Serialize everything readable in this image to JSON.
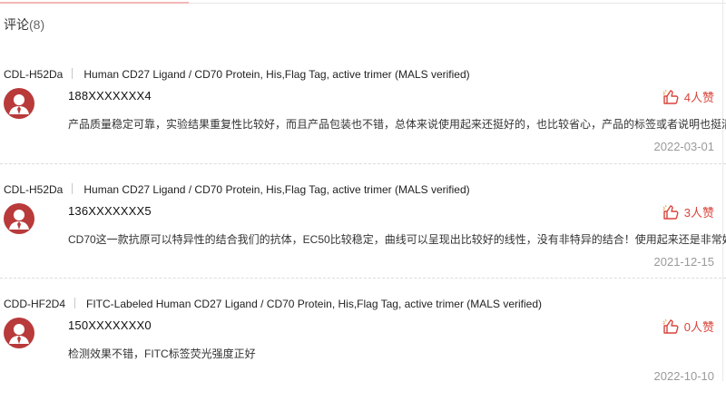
{
  "section": {
    "title": "评论",
    "count": "(8)"
  },
  "reviews": [
    {
      "catalog": "CDL-H52Da",
      "product": "Human CD27 Ligand / CD70 Protein, His,Flag Tag, active trimer (MALS verified)",
      "user": "188XXXXXXX4",
      "likes": "4人赞",
      "comment": "产品质量稳定可靠，实验结果重复性比较好，而且产品包装也不错，总体来说使用起来还挺好的，也比较省心，产品的标签或者说明也挺清晰的",
      "date": "2022-03-01"
    },
    {
      "catalog": "CDL-H52Da",
      "product": "Human CD27 Ligand / CD70 Protein, His,Flag Tag, active trimer (MALS verified)",
      "user": "136XXXXXXX5",
      "likes": "3人赞",
      "comment": "CD70这一款抗原可以特异性的结合我们的抗体，EC50比较稳定，曲线可以呈现出比较好的线性，没有非特异的结合！使用起来还是非常好的",
      "date": "2021-12-15"
    },
    {
      "catalog": "CDD-HF2D4",
      "product": "FITC-Labeled Human CD27 Ligand / CD70 Protein, His,Flag Tag, active trimer (MALS verified)",
      "user": "150XXXXXXX0",
      "likes": "0人赞",
      "comment": "检测效果不错，FITC标签荧光强度正好",
      "date": "2022-10-10"
    }
  ],
  "icons": {
    "avatar": "user-avatar-icon",
    "like": "thumbs-up-icon",
    "emoji": "smiley-emoji-icon"
  },
  "colors": {
    "accent": "#d9443c",
    "avatar": "#b93a3a",
    "date": "#9a9a9a"
  }
}
